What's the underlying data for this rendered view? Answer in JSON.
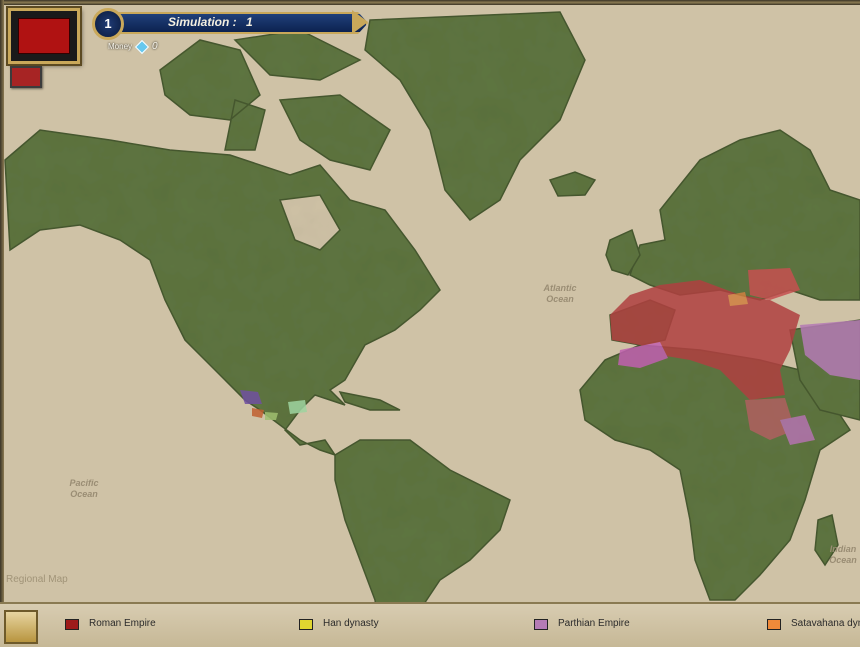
{
  "hud": {
    "turn_number": "1",
    "simulation_label": "Simulation :",
    "simulation_value": "1",
    "money_label": "Money",
    "money_value": "0"
  },
  "map": {
    "ocean_labels": [
      "Atlantic Ocean",
      "Pacific Ocean",
      "Indian Ocean"
    ],
    "regional_map_label": "Regional Map"
  },
  "legend": {
    "items": [
      {
        "label": "Roman Empire",
        "color": "#9e1b1b"
      },
      {
        "label": "Han dynasty",
        "color": "#e0d630"
      },
      {
        "label": "Parthian Empire",
        "color": "#b57bb5"
      },
      {
        "label": "Satavahana dyn",
        "color": "#f08a3a"
      }
    ]
  },
  "colors": {
    "land": "#5e7540",
    "sea": "#cfc2a6",
    "roman_territory": "#b04040",
    "berber": "#c060b0",
    "gold_frame": "#c9a85a",
    "banner_blue": "#0c2250"
  }
}
